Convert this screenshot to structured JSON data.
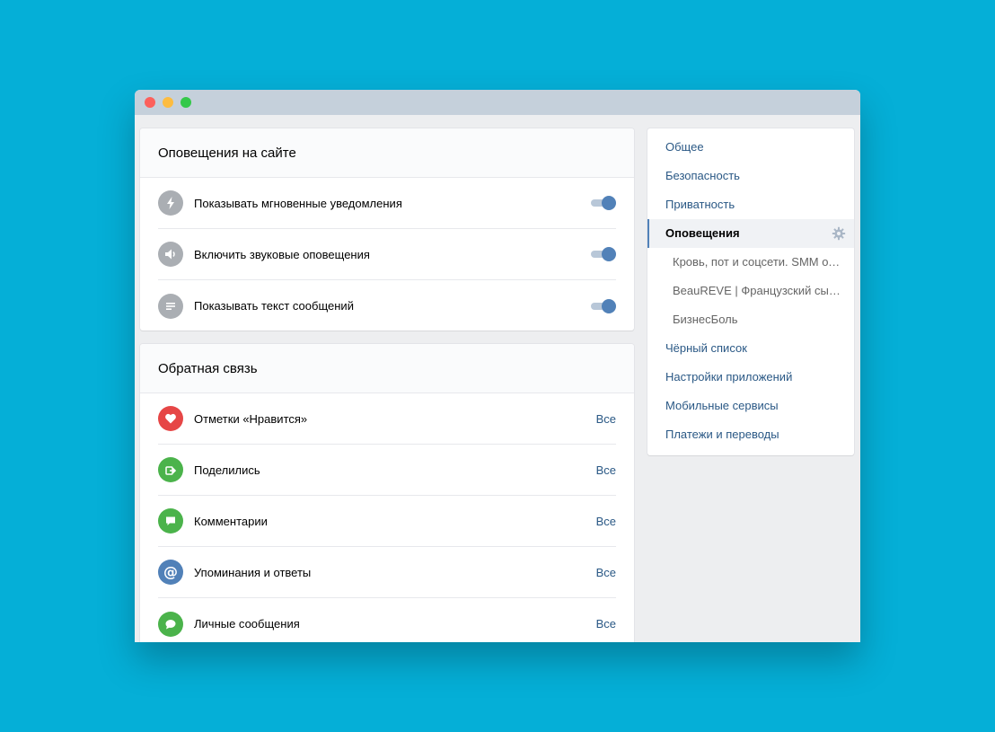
{
  "colors": {
    "background": "#05afd7",
    "accent": "#5181b8",
    "link": "#2a5885",
    "icon_gray": "#aaaeb3",
    "like_red": "#e64646",
    "green": "#4bb34b",
    "mention_blue": "#5181b8"
  },
  "site_notifications": {
    "title": "Оповещения на сайте",
    "rows": [
      {
        "label": "Показывать мгновенные уведомления",
        "icon": "lightning-icon",
        "enabled": true
      },
      {
        "label": "Включить звуковые оповещения",
        "icon": "speaker-icon",
        "enabled": true
      },
      {
        "label": "Показывать текст сообщений",
        "icon": "text-lines-icon",
        "enabled": true
      }
    ]
  },
  "feedback": {
    "title": "Обратная связь",
    "rows": [
      {
        "label": "Отметки «Нравится»",
        "value": "Все",
        "icon": "heart-icon"
      },
      {
        "label": "Поделились",
        "value": "Все",
        "icon": "share-icon"
      },
      {
        "label": "Комментарии",
        "value": "Все",
        "icon": "comment-icon"
      },
      {
        "label": "Упоминания и ответы",
        "value": "Все",
        "icon": "at-icon"
      },
      {
        "label": "Личные сообщения",
        "value": "Все",
        "icon": "message-icon"
      }
    ]
  },
  "sidebar": {
    "items": [
      {
        "label": "Общее"
      },
      {
        "label": "Безопасность"
      },
      {
        "label": "Приватность"
      },
      {
        "label": "Оповещения",
        "active": true
      },
      {
        "label": "Кровь, пот и соцсети. SMM от ...",
        "sub": true
      },
      {
        "label": "BeauREVE | Французский сыр ...",
        "sub": true
      },
      {
        "label": "БизнесБоль",
        "sub": true
      },
      {
        "label": "Чёрный список"
      },
      {
        "label": "Настройки приложений"
      },
      {
        "label": "Мобильные сервисы"
      },
      {
        "label": "Платежи и переводы"
      }
    ]
  }
}
